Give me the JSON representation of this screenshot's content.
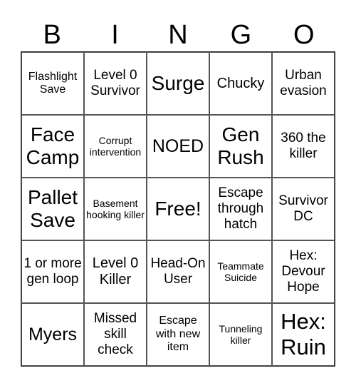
{
  "header": [
    "B",
    "I",
    "N",
    "G",
    "O"
  ],
  "cells": [
    "Flashlight Save",
    "Level 0 Survivor",
    "Surge",
    "Chucky",
    "Urban evasion",
    "Face Camp",
    "Corrupt intervention",
    "NOED",
    "Gen Rush",
    "360 the killer",
    "Pallet Save",
    "Basement hooking killer",
    "Free!",
    "Escape through hatch",
    "Survivor DC",
    "1 or more gen loop",
    "Level 0 Killer",
    "Head-On User",
    "Teammate Suicide",
    "Hex: Devour Hope",
    "Myers",
    "Missed skill check",
    "Escape with new item",
    "Tunneling killer",
    "Hex: Ruin"
  ]
}
